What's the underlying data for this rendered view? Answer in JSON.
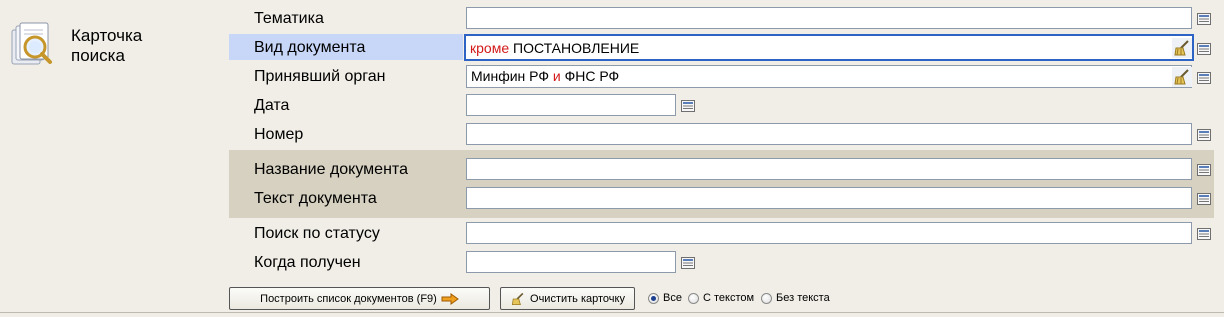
{
  "card": {
    "title_line1": "Карточка",
    "title_line2": "поиска"
  },
  "fields": {
    "tematika": {
      "label": "Тематика",
      "value": ""
    },
    "vid": {
      "label": "Вид документа",
      "value_prefix": "кроме",
      "value_main": "ПОСТАНОВЛЕНИЕ"
    },
    "organ": {
      "label": "Принявший орган",
      "value_a": "Минфин РФ",
      "value_op": "и",
      "value_b": "ФНС РФ"
    },
    "data": {
      "label": "Дата",
      "value": ""
    },
    "nomer": {
      "label": "Номер",
      "value": ""
    },
    "nazvanie": {
      "label": "Название документа",
      "value": ""
    },
    "tekst": {
      "label": "Текст документа",
      "value": ""
    },
    "status": {
      "label": "Поиск по статусу",
      "value": ""
    },
    "poluchen": {
      "label": "Когда получен",
      "value": ""
    }
  },
  "buttons": {
    "build": "Построить список документов (F9)",
    "clear": "Очистить карточку"
  },
  "radios": {
    "options": [
      "Все",
      "С текстом",
      "Без текста"
    ],
    "selected": "Все"
  },
  "colors": {
    "highlight_row": "#c8d7f8",
    "band": "#d6d1c0",
    "active_border": "#2e63c6",
    "operator_red": "#d31a1a"
  }
}
